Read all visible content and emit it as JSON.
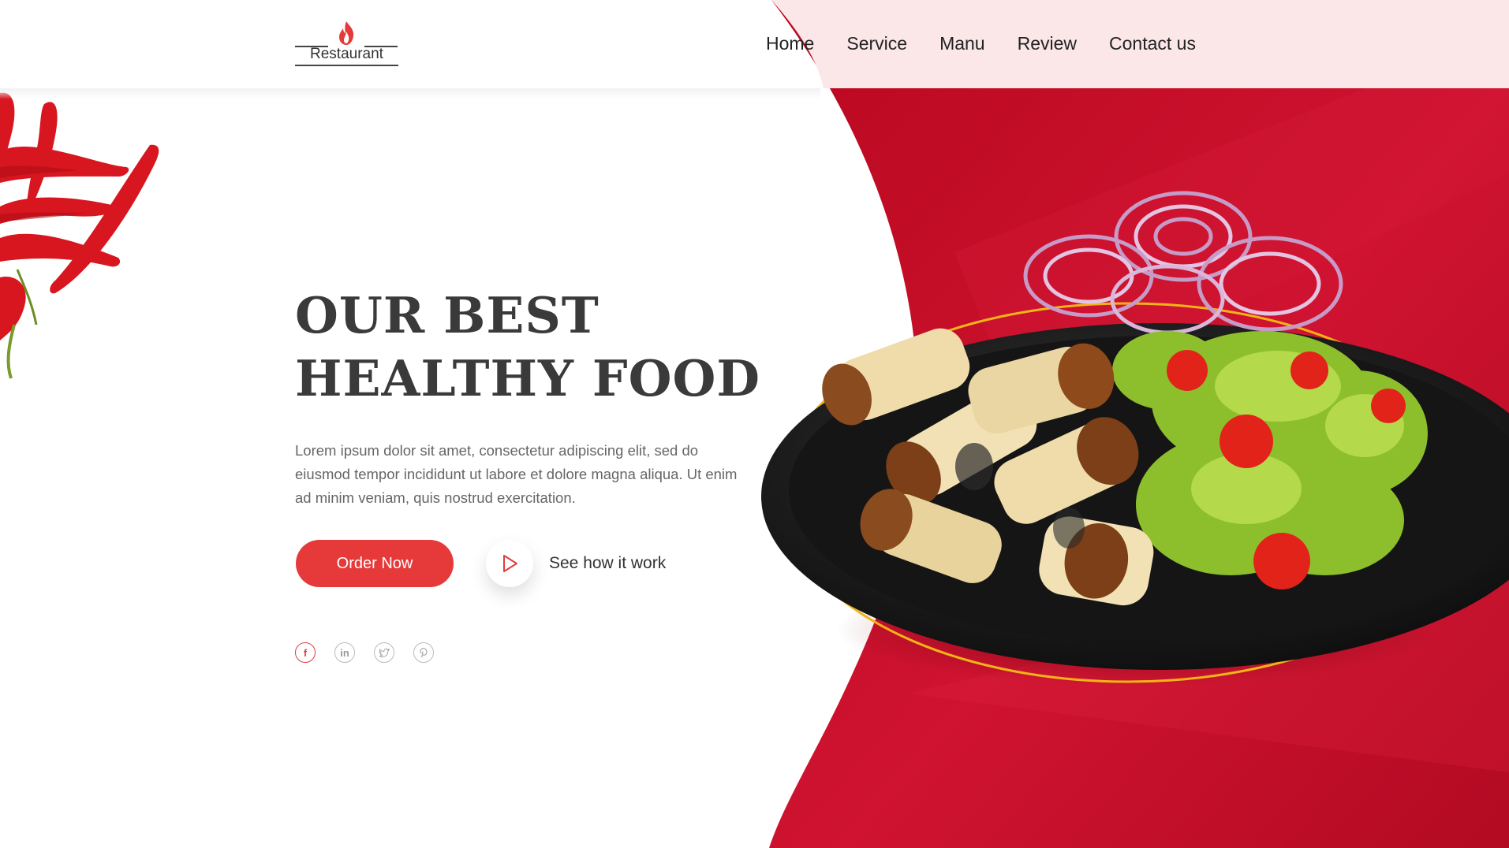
{
  "logo": {
    "text": "Restaurant"
  },
  "nav": {
    "items": [
      "Home",
      "Service",
      "Manu",
      "Review",
      "Contact us"
    ]
  },
  "hero": {
    "title_line1": "OUR BEST",
    "title_line2": "HEALTHY FOOD",
    "description": "Lorem ipsum dolor sit amet, consectetur adipiscing elit, sed do eiusmod tempor incididunt ut labore et dolore magna aliqua. Ut enim ad minim veniam, quis nostrud exercitation.",
    "order_button": "Order Now",
    "see_how": "See how it work"
  },
  "social": {
    "icons": [
      "facebook-icon",
      "linkedin-icon",
      "twitter-icon",
      "pinterest-icon"
    ]
  },
  "colors": {
    "accent": "#e63a3a",
    "hero_red": "#c8102e",
    "header_pink": "#fbe6e8",
    "ring_gold": "#f2b318"
  }
}
